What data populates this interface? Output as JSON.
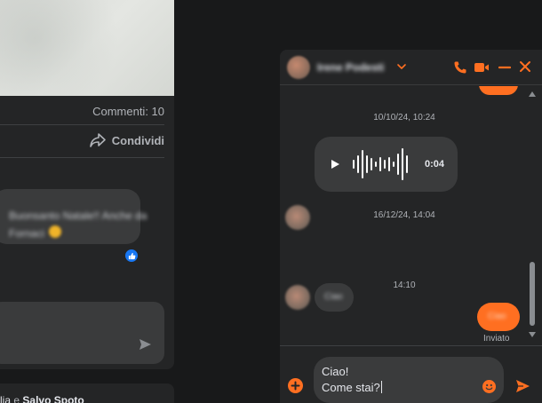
{
  "colors": {
    "accent": "#ff6f21",
    "background": "#18191a",
    "panel": "#242526",
    "bubble": "#3a3b3c",
    "text": "#e4e6eb",
    "muted": "#b0b3b8",
    "like_blue": "#1877f2"
  },
  "feed": {
    "comments_count": "Commenti: 10",
    "share_label": "Condividi",
    "share_icon": "share-arrow-icon",
    "comment_line1": "Buonsanto Natale!! Anche da",
    "comment_line2": "Fornaci",
    "reaction_icon": "thumbs-up-icon",
    "send_icon": "send-icon",
    "reactors": {
      "prefix": "lia",
      "conjunction": "e",
      "name": "Salvo Spoto"
    }
  },
  "chat": {
    "contact_name": "Irene Podesti",
    "header_icons": [
      "phone-icon",
      "video-icon",
      "minimize-icon",
      "close-icon"
    ],
    "timestamps": [
      "10/10/24, 10:24",
      "16/12/24, 14:04",
      "14:10"
    ],
    "voice_message": {
      "duration": "0:04",
      "play_icon": "play-icon"
    },
    "received_text": "Ciao",
    "sent_text": "Ciao",
    "sent_status": "Inviato",
    "composer": {
      "line1": "Ciao!",
      "line2": "Come stai?",
      "add_icon": "plus-circle-icon",
      "emoji_icon": "emoji-icon",
      "send_icon": "send-icon"
    }
  }
}
